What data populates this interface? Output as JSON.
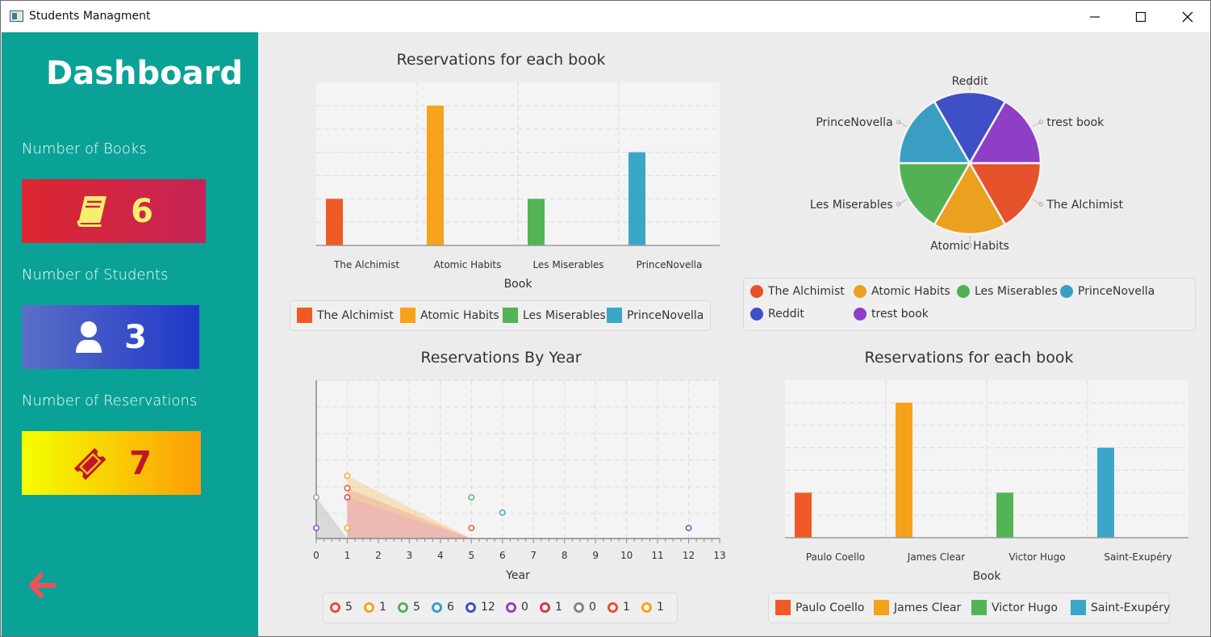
{
  "window": {
    "title": "Students Managment",
    "minimize": "—",
    "maximize": "☐",
    "close": "✕"
  },
  "sidebar": {
    "title": "Dashboard",
    "books": {
      "label": "Number of Books",
      "value": "6",
      "icon": "book-icon",
      "colors": [
        "#dc2730",
        "#c62356"
      ]
    },
    "students": {
      "label": "Number of Students",
      "value": "3",
      "icon": "user-icon",
      "colors": [
        "#5b6fc6",
        "#1f38c8"
      ]
    },
    "reservations": {
      "label": "Number of Reservations",
      "value": "7",
      "icon": "ticket-icon",
      "colors": [
        "#f5ff00",
        "#fd9e06"
      ]
    },
    "back_icon": "back-arrow-icon"
  },
  "chart_data": [
    {
      "type": "bar",
      "title": "Reservations for each book",
      "xlabel": "Book",
      "categories": [
        "The Alchimist",
        "Atomic Habits",
        "Les Miserables",
        "PrinceNovella"
      ],
      "series": [
        {
          "name": "The Alchimist",
          "color": "#f15a24",
          "values": [
            1,
            null,
            null,
            null
          ]
        },
        {
          "name": "Atomic Habits",
          "color": "#f7a21b",
          "values": [
            null,
            3,
            null,
            null
          ]
        },
        {
          "name": "Les Miserables",
          "color": "#53b455",
          "values": [
            null,
            null,
            1,
            null
          ]
        },
        {
          "name": "PrinceNovella",
          "color": "#3aa7c9",
          "values": [
            null,
            null,
            null,
            2
          ]
        }
      ],
      "ylim": [
        0,
        3.5
      ],
      "grid": true,
      "legend": "bottom"
    },
    {
      "type": "pie",
      "title": "",
      "slices": [
        {
          "label": "The Alchimist",
          "value": 1,
          "color": "#e5522b"
        },
        {
          "label": "Atomic Habits",
          "value": 1,
          "color": "#eba020"
        },
        {
          "label": "Les Miserables",
          "value": 1,
          "color": "#53b155"
        },
        {
          "label": "PrinceNovella",
          "value": 1,
          "color": "#3a9ec2"
        },
        {
          "label": "Reddit",
          "value": 1,
          "color": "#3f4fc6"
        },
        {
          "label": "trest book",
          "value": 1,
          "color": "#8e3fc6"
        }
      ],
      "legend": "bottom"
    },
    {
      "type": "area",
      "title": "Reservations By Year",
      "xlabel": "Year",
      "xlim": [
        0,
        13
      ],
      "xticks": [
        "0",
        "1",
        "2",
        "3",
        "4",
        "5",
        "6",
        "7",
        "8",
        "9",
        "10",
        "11",
        "12",
        "13"
      ],
      "points": [
        {
          "x": 0,
          "y": 1.0,
          "color": "#999999"
        },
        {
          "x": 0,
          "y": 0.0,
          "color": "#8e3fc6"
        },
        {
          "x": 1,
          "y": 1.7,
          "color": "#f7a21b"
        },
        {
          "x": 1,
          "y": 1.3,
          "color": "#e5522b"
        },
        {
          "x": 1,
          "y": 1.0,
          "color": "#d33a4d"
        },
        {
          "x": 1,
          "y": 0.0,
          "color": "#f7a21b"
        },
        {
          "x": 5,
          "y": 1.0,
          "color": "#53b155"
        },
        {
          "x": 5,
          "y": 0.0,
          "color": "#e5522b"
        },
        {
          "x": 6,
          "y": 0.5,
          "color": "#3a9ec2"
        },
        {
          "x": 12,
          "y": 0.0,
          "color": "#3f4fc6"
        }
      ],
      "series": [
        {
          "name": "5",
          "color": "#e5522b"
        },
        {
          "name": "1",
          "color": "#f7a21b"
        },
        {
          "name": "5",
          "color": "#53b155"
        },
        {
          "name": "6",
          "color": "#3a9ec2"
        },
        {
          "name": "12",
          "color": "#3f4fc6"
        },
        {
          "name": "0",
          "color": "#8e3fc6"
        },
        {
          "name": "1",
          "color": "#d33a4d"
        },
        {
          "name": "0",
          "color": "#888888"
        },
        {
          "name": "1",
          "color": "#e5522b"
        },
        {
          "name": "1",
          "color": "#f7a21b"
        }
      ],
      "grid": true,
      "legend": "bottom"
    },
    {
      "type": "bar",
      "title": "Reservations for each book",
      "xlabel": "Book",
      "categories": [
        "Paulo Coello",
        "James Clear",
        "Victor Hugo",
        "Saint-Exupéry"
      ],
      "series": [
        {
          "name": "Paulo Coello",
          "color": "#f15a24",
          "values": [
            1,
            null,
            null,
            null
          ]
        },
        {
          "name": "James Clear",
          "color": "#f7a21b",
          "values": [
            null,
            3,
            null,
            null
          ]
        },
        {
          "name": "Victor Hugo",
          "color": "#53b455",
          "values": [
            null,
            null,
            1,
            null
          ]
        },
        {
          "name": "Saint-Exupéry",
          "color": "#3aa7c9",
          "values": [
            null,
            null,
            null,
            2
          ]
        }
      ],
      "ylim": [
        0,
        3.5
      ],
      "grid": true,
      "legend": "bottom"
    }
  ]
}
